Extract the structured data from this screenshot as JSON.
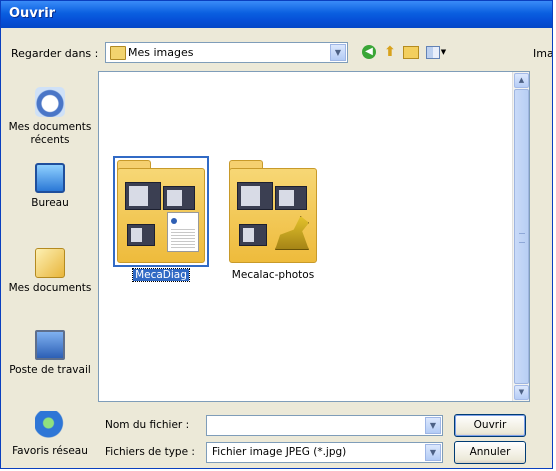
{
  "dialog": {
    "title": "Ouvrir"
  },
  "toolbar": {
    "look_in_label": "Regarder dans :",
    "look_in_value": "Mes images",
    "right_label": "Imag"
  },
  "places": [
    {
      "line1": "Mes documents",
      "line2": "récents",
      "icon": "recent-documents-icon"
    },
    {
      "line1": "Bureau",
      "line2": "",
      "icon": "desktop-icon"
    },
    {
      "line1": "Mes documents",
      "line2": "",
      "icon": "my-documents-icon"
    },
    {
      "line1": "Poste de travail",
      "line2": "",
      "icon": "my-computer-icon"
    },
    {
      "line1": "Favoris réseau",
      "line2": "",
      "icon": "network-places-icon"
    }
  ],
  "files": [
    {
      "name": "MecaDiag",
      "selected": true
    },
    {
      "name": "Mecalac-photos",
      "selected": false
    }
  ],
  "form": {
    "filename_label": "Nom du fichier :",
    "filename_value": "",
    "filetype_label": "Fichiers de type :",
    "filetype_value": "Fichier image JPEG (*.jpg)"
  },
  "buttons": {
    "open": "Ouvrir",
    "cancel": "Annuler"
  },
  "colors": {
    "titlebar": "#0a5fe0",
    "selection": "#316ac5",
    "dialog_bg": "#ece9d8"
  }
}
